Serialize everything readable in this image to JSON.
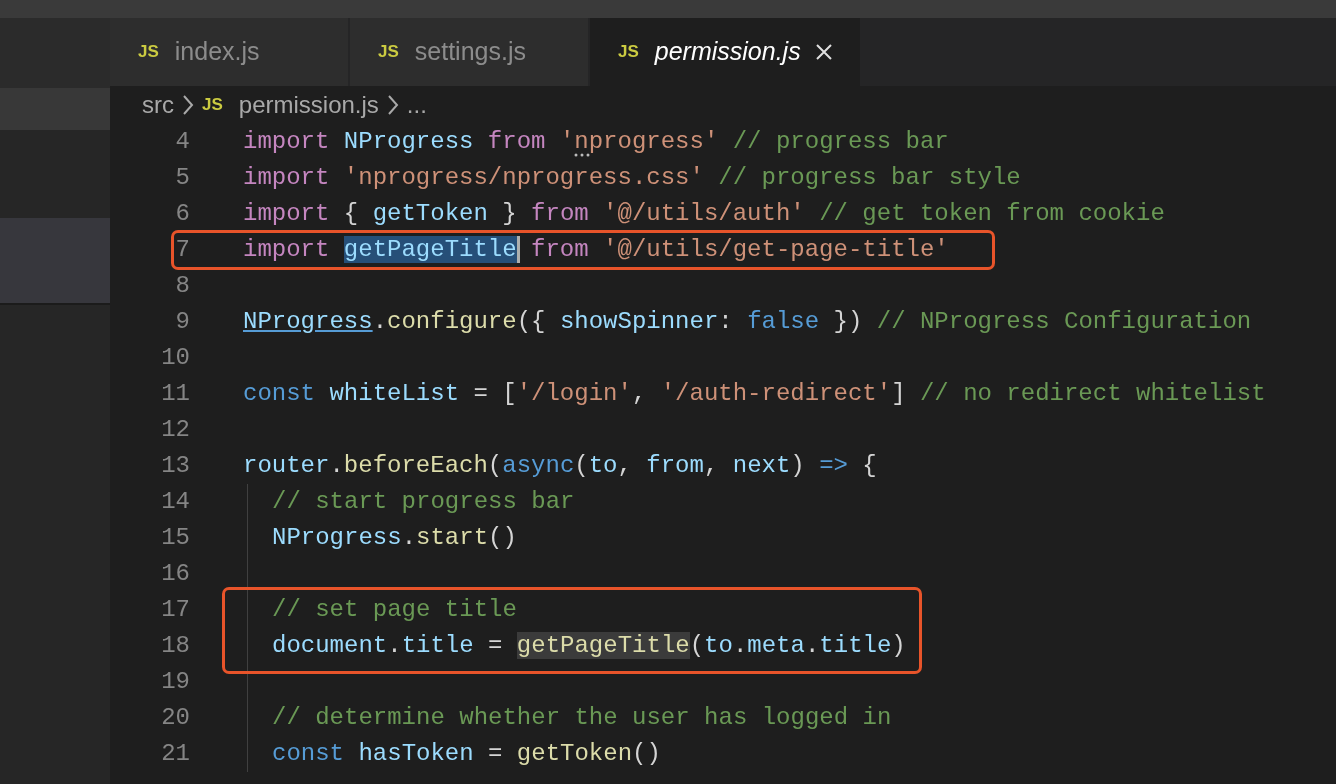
{
  "tabs": [
    {
      "icon_text": "JS",
      "label": "index.js",
      "selected": false
    },
    {
      "icon_text": "JS",
      "label": "settings.js",
      "selected": false
    },
    {
      "icon_text": "JS",
      "label": "permission.js",
      "selected": true
    }
  ],
  "breadcrumb": [
    {
      "kind": "folder",
      "label": "src"
    },
    {
      "kind": "file",
      "icon_text": "JS",
      "label": "permission.js"
    },
    {
      "kind": "more",
      "label": "..."
    }
  ],
  "lines": [
    {
      "number": "4",
      "indented": false,
      "boxed": false,
      "tokens": [
        {
          "kind": "keyword",
          "text": "import "
        },
        {
          "kind": "ident",
          "text": "NProgress "
        },
        {
          "kind": "keyword",
          "text": "from "
        },
        {
          "kind": "string",
          "text": "'nprogress'",
          "hint": true
        },
        {
          "kind": "comment",
          "text": " // progress bar"
        }
      ]
    },
    {
      "number": "5",
      "indented": false,
      "boxed": false,
      "tokens": [
        {
          "kind": "keyword",
          "text": "import "
        },
        {
          "kind": "string",
          "text": "'nprogress/nprogress.css'"
        },
        {
          "kind": "comment",
          "text": " // progress bar style"
        }
      ]
    },
    {
      "number": "6",
      "indented": false,
      "boxed": false,
      "tokens": [
        {
          "kind": "keyword",
          "text": "import"
        },
        {
          "kind": "plain",
          "text": " { "
        },
        {
          "kind": "ident",
          "text": "getToken"
        },
        {
          "kind": "plain",
          "text": " } "
        },
        {
          "kind": "keyword",
          "text": "from "
        },
        {
          "kind": "string",
          "text": "'@/utils/auth'"
        },
        {
          "kind": "comment",
          "text": " // get token from cookie"
        }
      ]
    },
    {
      "number": "7",
      "indented": false,
      "boxed": true,
      "gutter_boxed": true,
      "tokens": [
        {
          "kind": "keyword",
          "text": "import "
        },
        {
          "kind": "ident",
          "text": "getPageTitle",
          "selected": true
        },
        {
          "kind": "keyword",
          "text": " from "
        },
        {
          "kind": "string",
          "text": "'@/utils/get-page-title'"
        }
      ]
    },
    {
      "number": "8",
      "indented": false,
      "boxed": false
    },
    {
      "number": "9",
      "indented": false,
      "boxed": false,
      "tokens": [
        {
          "kind": "link",
          "text": "NProgress"
        },
        {
          "kind": "plain",
          "text": "."
        },
        {
          "kind": "func",
          "text": "configure"
        },
        {
          "kind": "plain",
          "text": "({ "
        },
        {
          "kind": "ident",
          "text": "showSpinner"
        },
        {
          "kind": "plain",
          "text": ": "
        },
        {
          "kind": "constant",
          "text": "false"
        },
        {
          "kind": "plain",
          "text": " }) "
        },
        {
          "kind": "comment",
          "text": "// NProgress Configuration"
        }
      ]
    },
    {
      "number": "10",
      "indented": false,
      "boxed": false
    },
    {
      "number": "11",
      "indented": false,
      "boxed": false,
      "tokens": [
        {
          "kind": "constant",
          "text": "const "
        },
        {
          "kind": "ident",
          "text": "whiteList"
        },
        {
          "kind": "plain",
          "text": " = ["
        },
        {
          "kind": "string",
          "text": "'/login'"
        },
        {
          "kind": "plain",
          "text": ", "
        },
        {
          "kind": "string",
          "text": "'/auth-redirect'"
        },
        {
          "kind": "plain",
          "text": "] "
        },
        {
          "kind": "comment",
          "text": "// no redirect whitelist"
        }
      ]
    },
    {
      "number": "12",
      "indented": false,
      "boxed": false
    },
    {
      "number": "13",
      "indented": false,
      "boxed": false,
      "tokens": [
        {
          "kind": "ident",
          "text": "router"
        },
        {
          "kind": "plain",
          "text": "."
        },
        {
          "kind": "func",
          "text": "beforeEach"
        },
        {
          "kind": "plain",
          "text": "("
        },
        {
          "kind": "constant",
          "text": "async"
        },
        {
          "kind": "plain",
          "text": "("
        },
        {
          "kind": "ident",
          "text": "to"
        },
        {
          "kind": "plain",
          "text": ", "
        },
        {
          "kind": "ident",
          "text": "from"
        },
        {
          "kind": "plain",
          "text": ", "
        },
        {
          "kind": "ident",
          "text": "next"
        },
        {
          "kind": "plain",
          "text": ") "
        },
        {
          "kind": "constant",
          "text": "=>"
        },
        {
          "kind": "plain",
          "text": " {"
        }
      ]
    },
    {
      "number": "14",
      "indented": true,
      "boxed": false,
      "tokens": [
        {
          "kind": "comment",
          "text": "// start progress bar"
        }
      ]
    },
    {
      "number": "15",
      "indented": true,
      "boxed": false,
      "tokens": [
        {
          "kind": "ident",
          "text": "NProgress"
        },
        {
          "kind": "plain",
          "text": "."
        },
        {
          "kind": "func",
          "text": "start"
        },
        {
          "kind": "plain",
          "text": "()"
        }
      ]
    },
    {
      "number": "16",
      "indented": true,
      "boxed": false
    },
    {
      "number": "17",
      "indented": true,
      "boxed": true,
      "gutter_boxed": false,
      "tokens": [
        {
          "kind": "comment",
          "text": "// set page title"
        }
      ]
    },
    {
      "number": "18",
      "indented": true,
      "boxed": true,
      "gutter_boxed": false,
      "tokens": [
        {
          "kind": "ident",
          "text": "document"
        },
        {
          "kind": "plain",
          "text": "."
        },
        {
          "kind": "ident",
          "text": "title"
        },
        {
          "kind": "plain",
          "text": " = "
        },
        {
          "kind": "func",
          "text": "getPageTitle",
          "highlighted": true
        },
        {
          "kind": "plain",
          "text": "("
        },
        {
          "kind": "ident",
          "text": "to"
        },
        {
          "kind": "plain",
          "text": "."
        },
        {
          "kind": "ident",
          "text": "meta"
        },
        {
          "kind": "plain",
          "text": "."
        },
        {
          "kind": "ident",
          "text": "title"
        },
        {
          "kind": "plain",
          "text": ")"
        }
      ]
    },
    {
      "number": "19",
      "indented": true,
      "boxed": false
    },
    {
      "number": "20",
      "indented": true,
      "boxed": false,
      "tokens": [
        {
          "kind": "comment",
          "text": "// determine whether the user has logged in"
        }
      ]
    },
    {
      "number": "21",
      "indented": true,
      "boxed": false,
      "tokens": [
        {
          "kind": "constant",
          "text": "const "
        },
        {
          "kind": "ident",
          "text": "hasToken"
        },
        {
          "kind": "plain",
          "text": " = "
        },
        {
          "kind": "func",
          "text": "getToken"
        },
        {
          "kind": "plain",
          "text": "()"
        }
      ]
    }
  ]
}
